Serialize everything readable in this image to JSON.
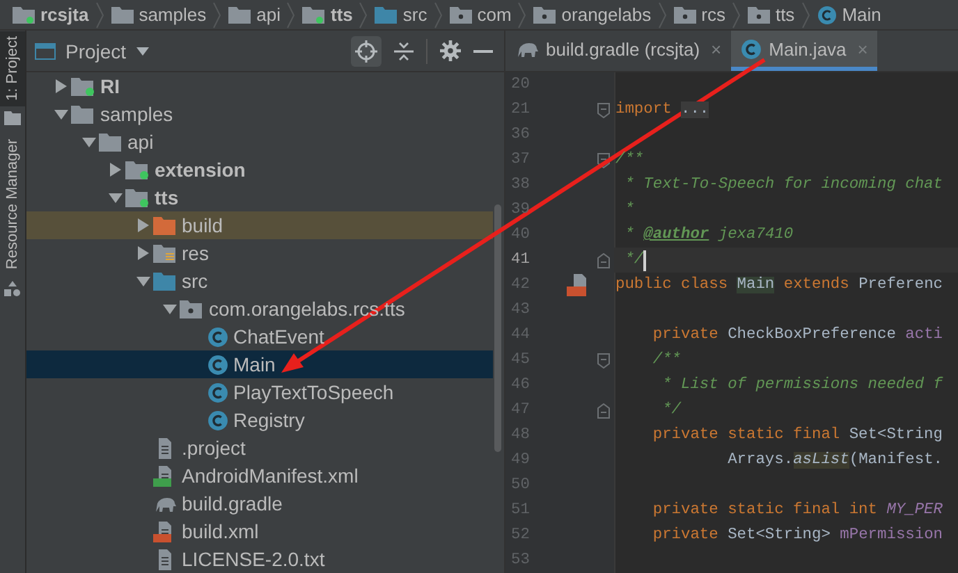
{
  "breadcrumb": [
    {
      "label": "rcsjta",
      "kind": "module",
      "bold": true
    },
    {
      "label": "samples",
      "kind": "folder",
      "bold": false
    },
    {
      "label": "api",
      "kind": "folder",
      "bold": false
    },
    {
      "label": "tts",
      "kind": "module",
      "bold": true
    },
    {
      "label": "src",
      "kind": "source",
      "bold": false
    },
    {
      "label": "com",
      "kind": "package",
      "bold": false
    },
    {
      "label": "orangelabs",
      "kind": "package",
      "bold": false
    },
    {
      "label": "rcs",
      "kind": "package",
      "bold": false
    },
    {
      "label": "tts",
      "kind": "package",
      "bold": false
    },
    {
      "label": "Main",
      "kind": "class",
      "bold": false
    }
  ],
  "sidebar": {
    "tabs": [
      {
        "label": "1: Project",
        "selected": true
      },
      {
        "label": "Resource Manager",
        "selected": false
      }
    ]
  },
  "project_panel": {
    "title": "Project",
    "tree": [
      {
        "label": "RI",
        "kind": "module",
        "bold": true,
        "expanded": false,
        "selected": false,
        "highlighted": false
      },
      {
        "label": "samples",
        "kind": "folder",
        "bold": false,
        "expanded": true,
        "selected": false,
        "highlighted": false,
        "children": [
          {
            "label": "api",
            "kind": "folder",
            "bold": false,
            "expanded": true,
            "selected": false,
            "highlighted": false,
            "children": [
              {
                "label": "extension",
                "kind": "module",
                "bold": true,
                "expanded": false,
                "selected": false,
                "highlighted": false
              },
              {
                "label": "tts",
                "kind": "module",
                "bold": true,
                "expanded": true,
                "selected": false,
                "highlighted": false,
                "children": [
                  {
                    "label": "build",
                    "kind": "excluded",
                    "bold": false,
                    "expanded": false,
                    "selected": false,
                    "highlighted": true
                  },
                  {
                    "label": "res",
                    "kind": "resources",
                    "bold": false,
                    "expanded": false,
                    "selected": false,
                    "highlighted": false
                  },
                  {
                    "label": "src",
                    "kind": "source",
                    "bold": false,
                    "expanded": true,
                    "selected": false,
                    "highlighted": false,
                    "children": [
                      {
                        "label": "com.orangelabs.rcs.tts",
                        "kind": "package",
                        "bold": false,
                        "expanded": true,
                        "selected": false,
                        "highlighted": false,
                        "children": [
                          {
                            "label": "ChatEvent",
                            "kind": "class",
                            "bold": false,
                            "selected": false,
                            "highlighted": false
                          },
                          {
                            "label": "Main",
                            "kind": "class",
                            "bold": false,
                            "selected": true,
                            "highlighted": false
                          },
                          {
                            "label": "PlayTextToSpeech",
                            "kind": "class",
                            "bold": false,
                            "selected": false,
                            "highlighted": false
                          },
                          {
                            "label": "Registry",
                            "kind": "class",
                            "bold": false,
                            "selected": false,
                            "highlighted": false
                          }
                        ]
                      }
                    ]
                  },
                  {
                    "label": ".project",
                    "kind": "text",
                    "bold": false,
                    "selected": false,
                    "highlighted": false
                  },
                  {
                    "label": "AndroidManifest.xml",
                    "kind": "manifest",
                    "bold": false,
                    "selected": false,
                    "highlighted": false
                  },
                  {
                    "label": "build.gradle",
                    "kind": "gradle",
                    "bold": false,
                    "selected": false,
                    "highlighted": false
                  },
                  {
                    "label": "build.xml",
                    "kind": "xml",
                    "bold": false,
                    "selected": false,
                    "highlighted": false
                  },
                  {
                    "label": "LICENSE-2.0.txt",
                    "kind": "text",
                    "bold": false,
                    "selected": false,
                    "highlighted": false
                  }
                ]
              }
            ]
          }
        ]
      }
    ]
  },
  "editor": {
    "tabs": [
      {
        "label": "build.gradle (rcsjta)",
        "kind": "gradle",
        "selected": false,
        "close": "×"
      },
      {
        "label": "Main.java",
        "kind": "class",
        "selected": true,
        "close": "×"
      }
    ],
    "lines": [
      {
        "number": "20",
        "current": false,
        "kind": "plain"
      },
      {
        "number": "21",
        "current": false,
        "kind": "fold-start",
        "tokens": [
          {
            "text": "import ",
            "kind": "keyword"
          },
          {
            "text": "...",
            "kind": "folded"
          }
        ]
      },
      {
        "number": "36",
        "current": false,
        "kind": "plain"
      },
      {
        "number": "37",
        "current": false,
        "kind": "fold-start",
        "tokens": [
          {
            "text": "/**",
            "kind": "doc"
          }
        ]
      },
      {
        "number": "38",
        "current": false,
        "kind": "plain",
        "tokens": [
          {
            "text": " * Text-To-Speech for incoming chat",
            "kind": "doc"
          }
        ]
      },
      {
        "number": "39",
        "current": false,
        "kind": "plain",
        "tokens": [
          {
            "text": " *",
            "kind": "doc"
          }
        ]
      },
      {
        "number": "40",
        "current": false,
        "kind": "plain",
        "tokens": [
          {
            "text": " * ",
            "kind": "doc"
          },
          {
            "text": "@author",
            "kind": "doctag"
          },
          {
            "text": " jexa7410",
            "kind": "doc"
          }
        ]
      },
      {
        "number": "41",
        "current": true,
        "kind": "fold-end",
        "tokens": [
          {
            "text": " */",
            "kind": "doc"
          }
        ]
      },
      {
        "number": "42",
        "current": false,
        "kind": "class-marker",
        "tokens": [
          {
            "text": "public class ",
            "kind": "keyword"
          },
          {
            "text": "Main",
            "kind": "usage"
          },
          {
            "text": " extends ",
            "kind": "keyword"
          },
          {
            "text": "Preferenc",
            "kind": "plain"
          }
        ]
      },
      {
        "number": "43",
        "current": false,
        "kind": "plain"
      },
      {
        "number": "44",
        "current": false,
        "kind": "plain",
        "tokens": [
          {
            "text": "    private ",
            "kind": "keyword"
          },
          {
            "text": "CheckBoxPreference ",
            "kind": "plain"
          },
          {
            "text": "acti",
            "kind": "field"
          }
        ]
      },
      {
        "number": "45",
        "current": false,
        "kind": "fold-start",
        "tokens": [
          {
            "text": "    /**",
            "kind": "doc"
          }
        ]
      },
      {
        "number": "46",
        "current": false,
        "kind": "plain",
        "tokens": [
          {
            "text": "     * List of permissions needed f",
            "kind": "doc"
          }
        ]
      },
      {
        "number": "47",
        "current": false,
        "kind": "fold-end",
        "tokens": [
          {
            "text": "     */",
            "kind": "doc"
          }
        ]
      },
      {
        "number": "48",
        "current": false,
        "kind": "plain",
        "tokens": [
          {
            "text": "    private static final ",
            "kind": "keyword"
          },
          {
            "text": "Set<String",
            "kind": "plain"
          }
        ]
      },
      {
        "number": "49",
        "current": false,
        "kind": "plain",
        "tokens": [
          {
            "text": "            Arrays.",
            "kind": "plain"
          },
          {
            "text": "asList",
            "kind": "static-usage"
          },
          {
            "text": "(Manifest.",
            "kind": "plain"
          }
        ]
      },
      {
        "number": "50",
        "current": false,
        "kind": "plain"
      },
      {
        "number": "51",
        "current": false,
        "kind": "plain",
        "tokens": [
          {
            "text": "    private static final int ",
            "kind": "keyword"
          },
          {
            "text": "MY_PER",
            "kind": "constant"
          }
        ]
      },
      {
        "number": "52",
        "current": false,
        "kind": "plain",
        "tokens": [
          {
            "text": "    private ",
            "kind": "keyword"
          },
          {
            "text": "Set<String> ",
            "kind": "plain"
          },
          {
            "text": "mPermission",
            "kind": "field"
          }
        ]
      },
      {
        "number": "53",
        "current": false,
        "kind": "plain"
      }
    ]
  }
}
